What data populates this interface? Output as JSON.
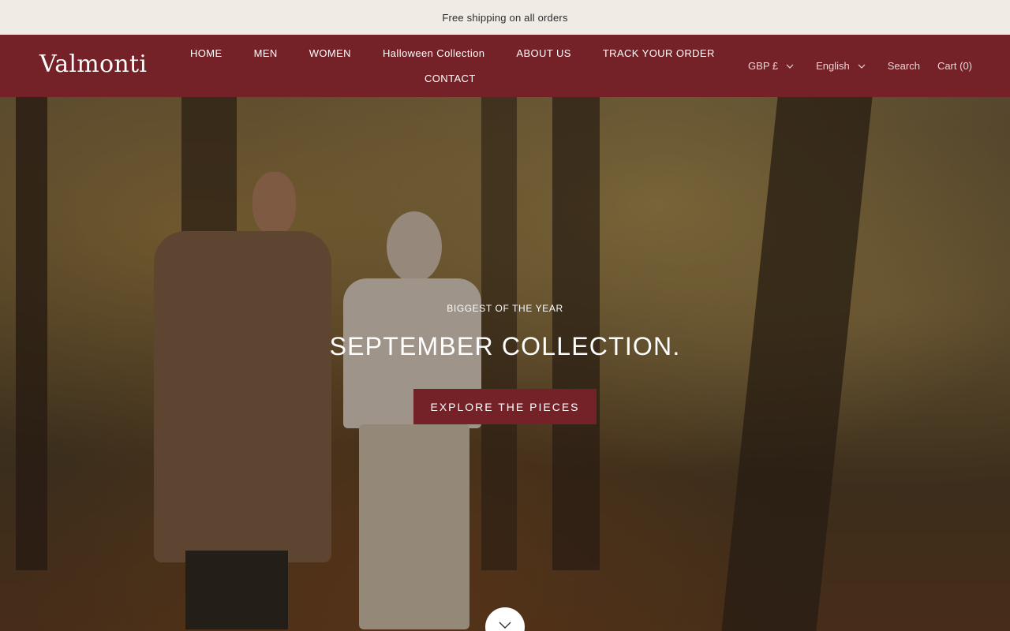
{
  "announcement": {
    "text": "Free shipping on all orders"
  },
  "header": {
    "logo": "Valmonti",
    "nav": [
      "HOME",
      "MEN",
      "WOMEN",
      "Halloween Collection",
      "ABOUT US",
      "TRACK YOUR ORDER",
      "CONTACT"
    ],
    "currency": "GBP £",
    "language": "English",
    "search": "Search",
    "cart": "Cart (0)"
  },
  "hero": {
    "eyebrow": "BIGGEST OF THE YEAR",
    "title": "SEPTEMBER COLLECTION.",
    "cta": "EXPLORE THE PIECES"
  },
  "colors": {
    "brand": "#742228",
    "announcement_bg": "#f1ebe6"
  },
  "icons": {
    "dropdown": "chevron-down-icon",
    "scroll": "chevron-down-icon"
  }
}
